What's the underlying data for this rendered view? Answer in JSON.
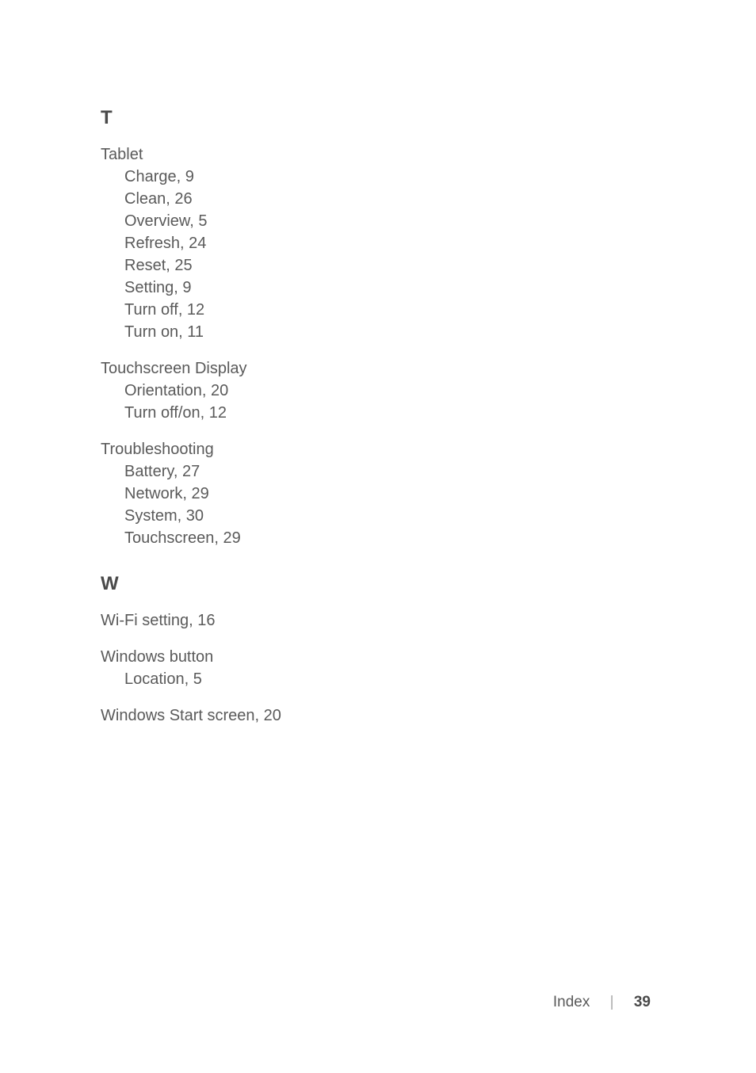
{
  "sections": {
    "T": {
      "letter": "T",
      "entries": {
        "tablet": {
          "term": "Tablet",
          "subs": {
            "charge": "Charge, 9",
            "clean": "Clean, 26",
            "overview": "Overview, 5",
            "refresh": "Refresh, 24",
            "reset": "Reset, 25",
            "setting": "Setting, 9",
            "turnoff": "Turn off, 12",
            "turnon": "Turn on, 11"
          }
        },
        "touchscreen": {
          "term": "Touchscreen Display",
          "subs": {
            "orientation": "Orientation, 20",
            "turnoffon": "Turn off/on, 12"
          }
        },
        "troubleshooting": {
          "term": "Troubleshooting",
          "subs": {
            "battery": "Battery, 27",
            "network": "Network, 29",
            "system": "System, 30",
            "touchscreen": "Touchscreen, 29"
          }
        }
      }
    },
    "W": {
      "letter": "W",
      "entries": {
        "wifi": {
          "term": "Wi-Fi setting, 16"
        },
        "winbutton": {
          "term": "Windows button",
          "subs": {
            "location": "Location, 5"
          }
        },
        "winstart": {
          "term": "Windows Start screen, 20"
        }
      }
    }
  },
  "footer": {
    "label": "Index",
    "page": "39"
  }
}
